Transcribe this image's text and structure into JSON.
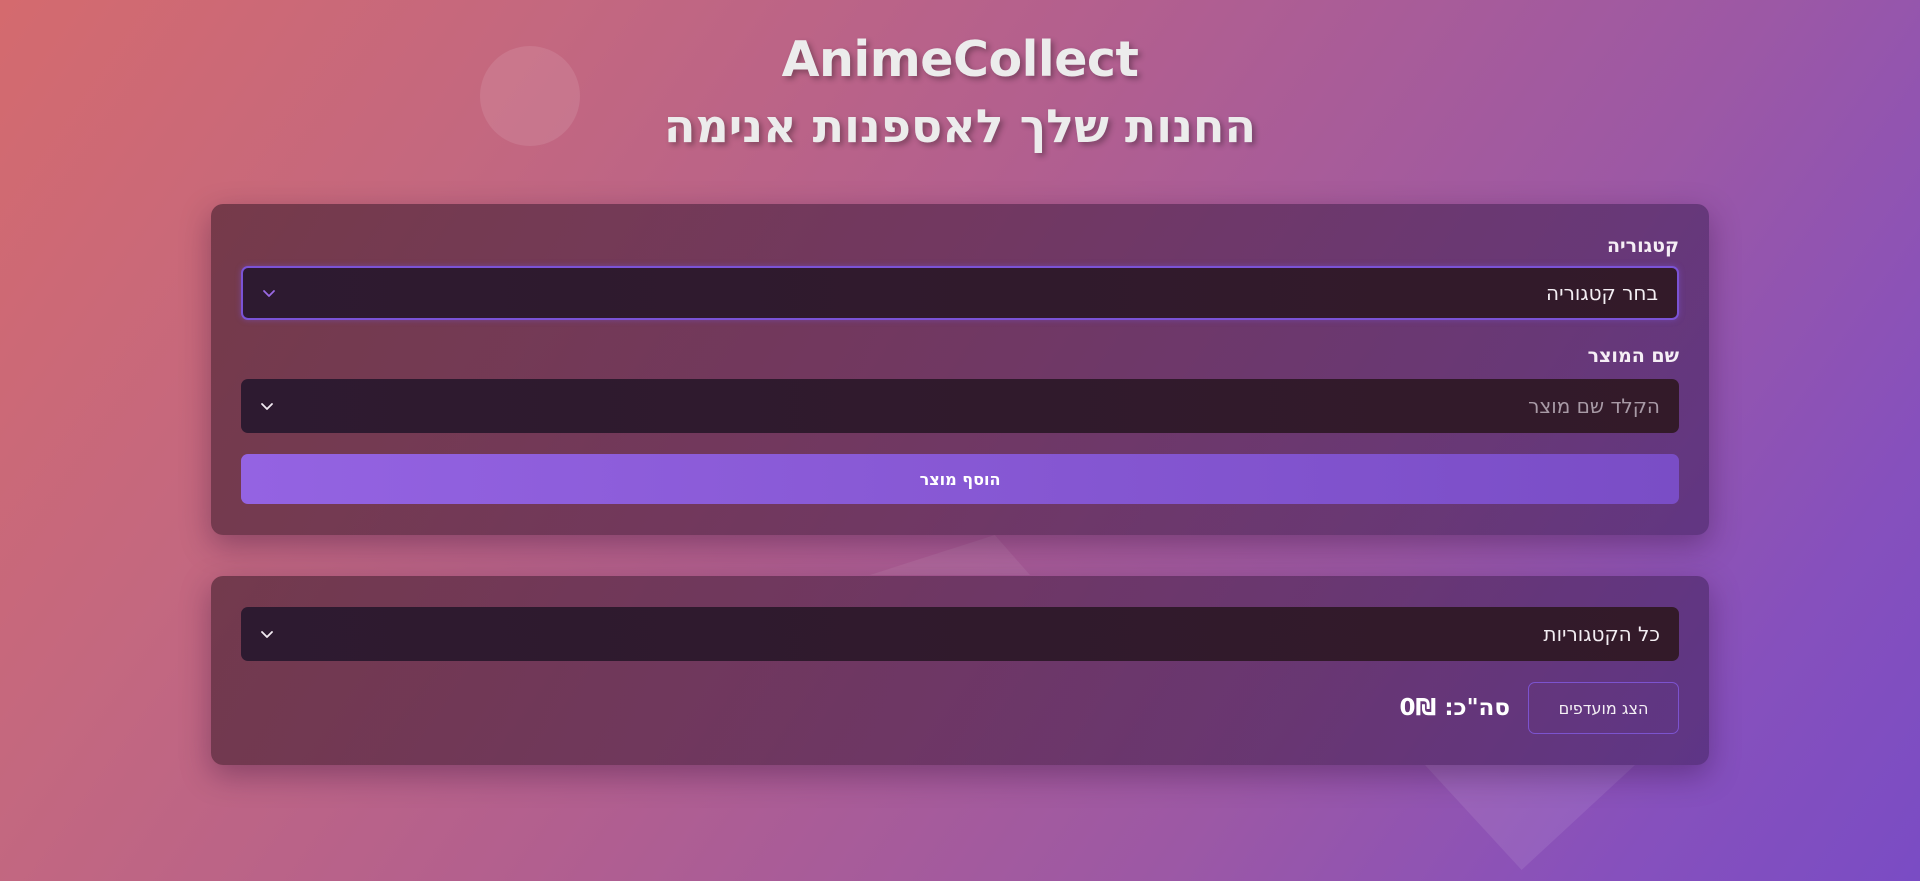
{
  "header": {
    "brand": "AnimeCollect",
    "tagline": "החנות שלך לאספנות אנימה"
  },
  "add_form": {
    "category_label": "קטגוריה",
    "category_select_value": "בחר קטגוריה",
    "product_label": "שם המוצר",
    "product_placeholder": "הקלד שם מוצר",
    "add_button_label": "הוסף מוצר"
  },
  "filter_panel": {
    "category_filter_value": "כל הקטגוריות",
    "favorites_button_label": "הצג מועדפים",
    "total_text": "סה\"כ: 0₪"
  },
  "icons": {
    "select_arrow": "chevron-down-icon"
  },
  "colors": {
    "accent": "#8a5ad8",
    "button_gradient_start": "#9463e2",
    "button_gradient_end": "#7a4dc6",
    "focus_border": "#7b53d6"
  }
}
